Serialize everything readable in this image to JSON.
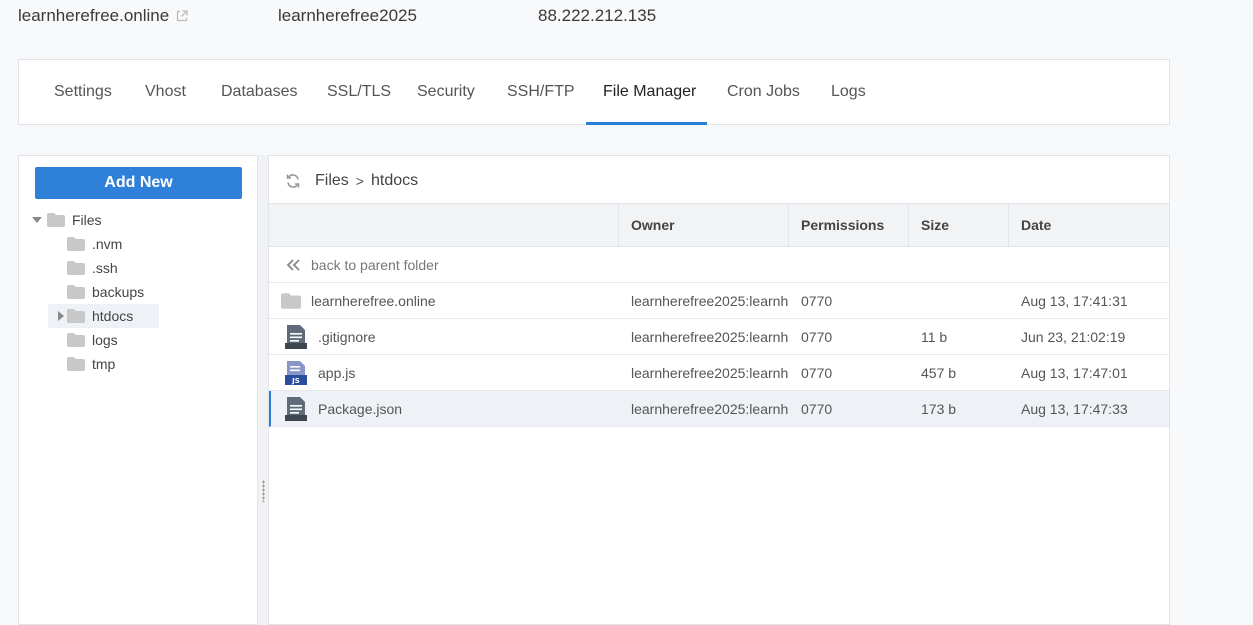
{
  "topbar": {
    "domain": "learnherefree.online",
    "username": "learnherefree2025",
    "ip": "88.222.212.135"
  },
  "tabs": [
    {
      "label": "Settings"
    },
    {
      "label": "Vhost"
    },
    {
      "label": "Databases"
    },
    {
      "label": "SSL/TLS"
    },
    {
      "label": "Security"
    },
    {
      "label": "SSH/FTP"
    },
    {
      "label": "File Manager",
      "active": true
    },
    {
      "label": "Cron Jobs"
    },
    {
      "label": "Logs"
    }
  ],
  "sidebar": {
    "add_new_label": "Add New",
    "tree": {
      "root": "Files",
      "items": [
        {
          "label": ".nvm"
        },
        {
          "label": ".ssh"
        },
        {
          "label": "backups"
        },
        {
          "label": "htdocs",
          "selected": true
        },
        {
          "label": "logs"
        },
        {
          "label": "tmp"
        }
      ]
    }
  },
  "breadcrumb": {
    "root": "Files",
    "separator": ">",
    "current": "htdocs"
  },
  "table": {
    "columns": {
      "owner": "Owner",
      "permissions": "Permissions",
      "size": "Size",
      "date": "Date"
    },
    "back_label": "back to parent folder",
    "rows": [
      {
        "name": "learnherefree.online",
        "type": "folder",
        "owner": "learnherefree2025:learnh",
        "permissions": "0770",
        "size": "",
        "date": "Aug 13, 17:41:31"
      },
      {
        "name": ".gitignore",
        "type": "text",
        "owner": "learnherefree2025:learnh",
        "permissions": "0770",
        "size": "11 b",
        "date": "Jun 23, 21:02:19"
      },
      {
        "name": "app.js",
        "type": "js",
        "owner": "learnherefree2025:learnh",
        "permissions": "0770",
        "size": "457 b",
        "date": "Aug 13, 17:47:01"
      },
      {
        "name": "Package.json",
        "type": "text",
        "owner": "learnherefree2025:learnh",
        "permissions": "0770",
        "size": "173 b",
        "date": "Aug 13, 17:47:33",
        "selected": true
      }
    ]
  },
  "colors": {
    "accent": "#2a7ed8",
    "button": "#2f80d8",
    "folder": "#c8c8c8",
    "file_icon": "#5f6b78",
    "js_badge": "#2b4d9e"
  }
}
